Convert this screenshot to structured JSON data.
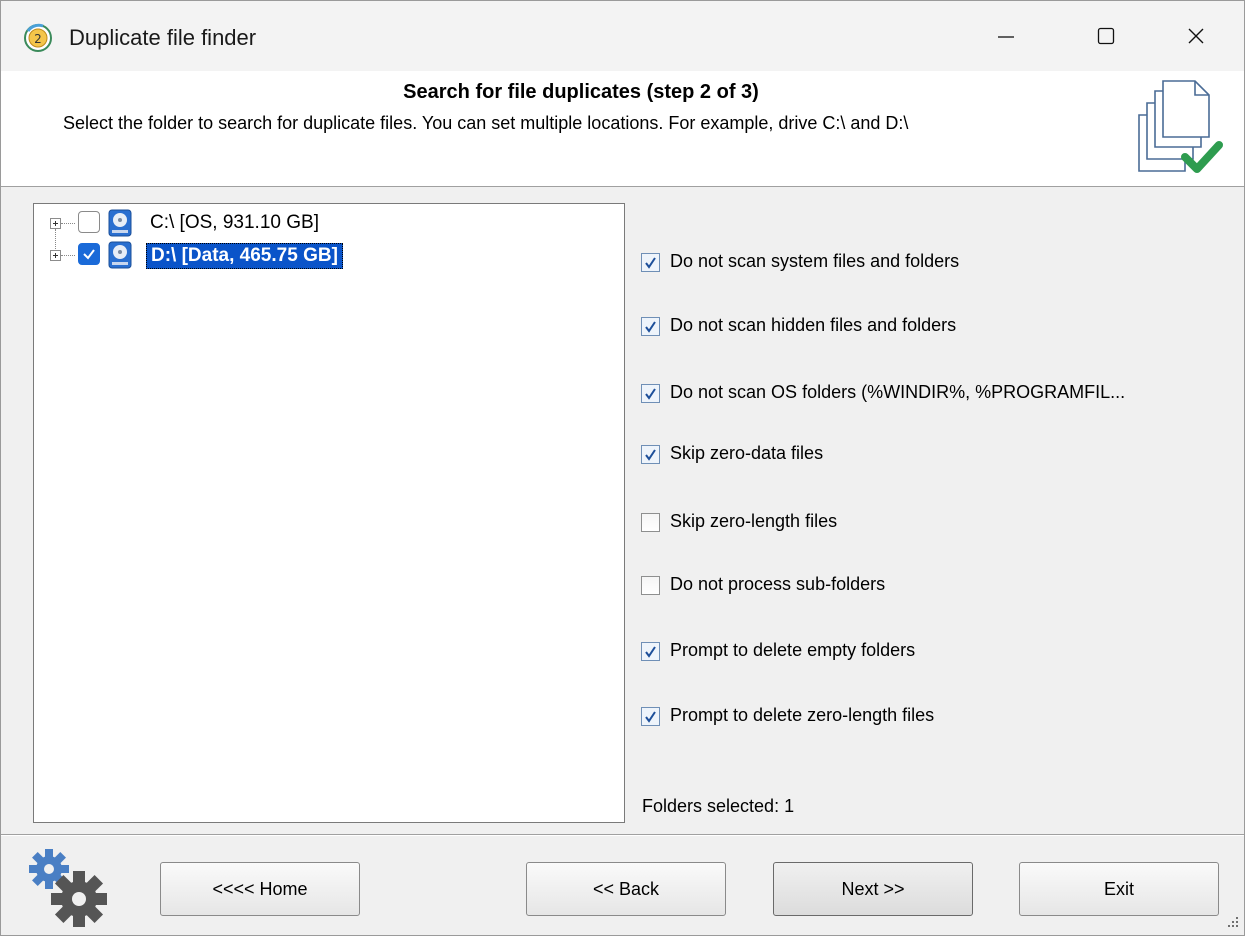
{
  "window": {
    "title": "Duplicate file finder"
  },
  "header": {
    "title": "Search for file duplicates (step 2 of 3)",
    "subtitle": "Select the folder to search for duplicate files. You can set multiple locations. For example, drive C:\\ and D:\\"
  },
  "tree": {
    "items": [
      {
        "label": "C:\\ [OS, 931.10 GB]",
        "checked": false,
        "selected": false
      },
      {
        "label": "D:\\ [Data, 465.75 GB]",
        "checked": true,
        "selected": true
      }
    ]
  },
  "options": [
    {
      "label": "Do not scan system files and folders",
      "checked": true
    },
    {
      "label": "Do not scan hidden files and folders",
      "checked": true
    },
    {
      "label": "Do not scan OS folders (%WINDIR%, %PROGRAMFIL...",
      "checked": true
    },
    {
      "label": "Skip zero-data files",
      "checked": true
    },
    {
      "label": "Skip zero-length files",
      "checked": false
    },
    {
      "label": "Do not process sub-folders",
      "checked": false
    },
    {
      "label": "Prompt to delete empty folders",
      "checked": true
    },
    {
      "label": "Prompt to delete zero-length files",
      "checked": true
    }
  ],
  "status": {
    "folders_selected": "Folders selected: 1"
  },
  "buttons": {
    "home": "<<<< Home",
    "back": "<< Back",
    "next": "Next >>",
    "exit": "Exit"
  },
  "colors": {
    "selection": "#0a54c9",
    "check_accent": "#1a6ad8",
    "ok_green": "#2e9c4f"
  }
}
